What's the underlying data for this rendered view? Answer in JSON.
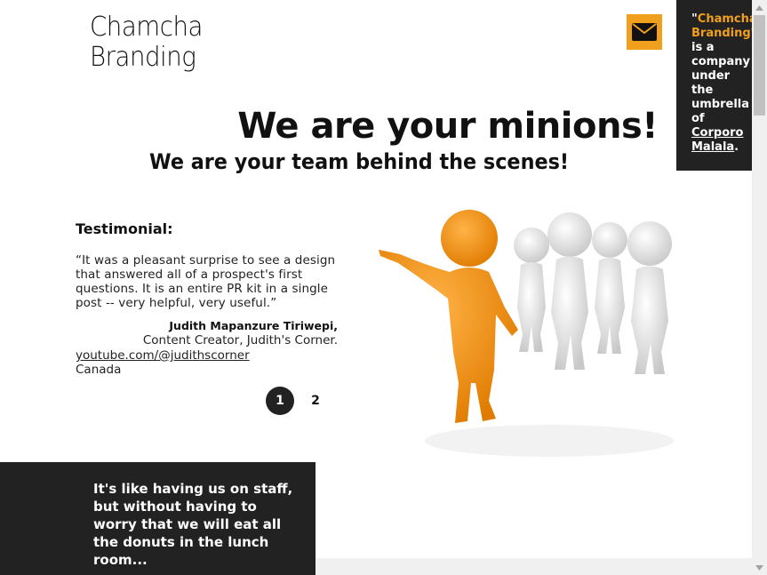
{
  "brand": {
    "line1": "Chamcha",
    "line2": "Branding"
  },
  "contact": {
    "icon": "envelope-icon",
    "accent": "#f0a01c"
  },
  "side_note": {
    "quote_open": "\"",
    "brand_name": "Chamcha Branding",
    "quote_close": "\"",
    "text": " is a company under the umbrella of ",
    "link": "Corporo Malala",
    "period": "."
  },
  "hero": {
    "headline": "We are your minions!",
    "subheadline": "We are your team behind the scenes!"
  },
  "testimonial": {
    "heading": "Testimonial:",
    "quote": "“It was a pleasant surprise to see a design that answered all of a prospect's first questions. It is an entire PR kit in a single post -- very helpful, very useful.”",
    "author": "Judith Mapanzure Tiriwepi,",
    "role": "Content Creator, Judith's Corner.",
    "link": "youtube.com/@judithscorner",
    "country": "Canada"
  },
  "pagination": {
    "pages": [
      "1",
      "2"
    ],
    "active": "1"
  },
  "footer_note": "It's like having us on staff, but without having to worry that we will eat all the donuts in the lunch room...",
  "colors": {
    "dark": "#222222",
    "accent": "#f0a01c",
    "figure_orange": "#f39a1e",
    "figure_white": "#e8e8e8"
  }
}
